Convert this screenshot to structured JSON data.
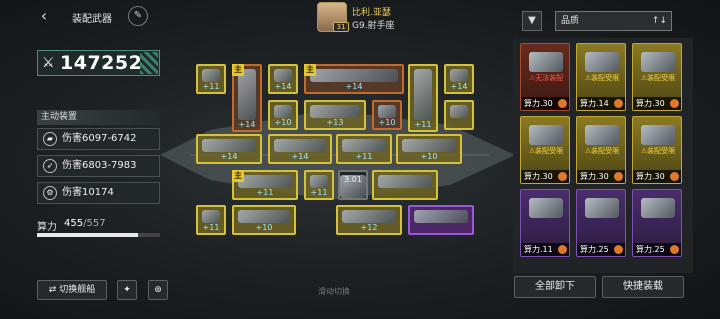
{
  "header": {
    "back_icon": "‹",
    "title": "装配武器",
    "edit_icon": "✎"
  },
  "captain": {
    "level": "31",
    "name": "比利.亚瑟",
    "subtitle": "G9.射手座"
  },
  "power": {
    "value": "147252"
  },
  "active_section": {
    "label": "主动装置",
    "items": [
      {
        "text": "伤害6097-6742",
        "icon": "gun-icon"
      },
      {
        "text": "伤害6803-7983",
        "icon": "missile-icon"
      },
      {
        "text": "伤害10174",
        "icon": "gear-icon"
      }
    ]
  },
  "capacity": {
    "label": "算力",
    "current": "455",
    "max": "/557",
    "fill_fraction": 0.82
  },
  "bottom_left": {
    "switch_label": "⇄ 切换舰船"
  },
  "scroll_hint": "滑动切换",
  "right_top": {
    "sort_label": "品质"
  },
  "cards": [
    {
      "color": "r",
      "warn": "无法装配",
      "warn_color": "red",
      "power": "算力.30"
    },
    {
      "color": "y",
      "warn": "装配受限",
      "warn_color": "yel",
      "power": "算力.14"
    },
    {
      "color": "y",
      "warn": "装配受限",
      "warn_color": "yel",
      "power": "算力.30"
    },
    {
      "color": "y",
      "warn": "装配受限",
      "warn_color": "yel",
      "power": "算力.30"
    },
    {
      "color": "y",
      "warn": "装配受限",
      "warn_color": "yel",
      "power": "算力.30"
    },
    {
      "color": "y",
      "warn": "装配受限",
      "warn_color": "yel",
      "power": "算力.30"
    },
    {
      "color": "p",
      "warn": "",
      "warn_color": "yel",
      "power": "算力.11"
    },
    {
      "color": "p",
      "warn": "",
      "warn_color": "yel",
      "power": "算力.25"
    },
    {
      "color": "p",
      "warn": "",
      "warn_color": "yel",
      "power": "算力.25"
    }
  ],
  "buttons": {
    "unequip_all": "全部卸下",
    "quick_equip": "快捷装载"
  },
  "slots": [
    {
      "c": "y",
      "lv": "+11",
      "badge": ""
    },
    {
      "c": "o",
      "lv": "+14",
      "badge": "主"
    },
    {
      "c": "y",
      "lv": "+14",
      "badge": ""
    },
    {
      "c": "y",
      "lv": "+10",
      "badge": ""
    },
    {
      "c": "o",
      "lv": "+14",
      "badge": "主"
    },
    {
      "c": "y",
      "lv": "+13",
      "badge": ""
    },
    {
      "c": "o",
      "lv": "+10",
      "badge": ""
    },
    {
      "c": "y",
      "lv": "+11",
      "badge": ""
    },
    {
      "c": "y",
      "lv": "+14",
      "badge": ""
    },
    {
      "c": "y",
      "lv": "+14",
      "badge": ""
    },
    {
      "c": "y",
      "lv": "+14",
      "badge": ""
    },
    {
      "c": "y",
      "lv": "+11",
      "badge": ""
    },
    {
      "c": "y",
      "lv": "+10",
      "badge": ""
    },
    {
      "c": "y",
      "lv": "+11",
      "badge": "主"
    },
    {
      "c": "y",
      "lv": "+11",
      "badge": ""
    },
    {
      "c": "d",
      "lv": "3.01",
      "badge": ""
    },
    {
      "c": "y",
      "lv": "",
      "badge": ""
    },
    {
      "c": "y",
      "lv": "+11",
      "badge": ""
    },
    {
      "c": "y",
      "lv": "+10",
      "badge": ""
    },
    {
      "c": "y",
      "lv": "+12",
      "badge": ""
    },
    {
      "c": "p",
      "lv": "",
      "badge": ""
    },
    {
      "c": "y",
      "lv": "",
      "badge": ""
    }
  ]
}
